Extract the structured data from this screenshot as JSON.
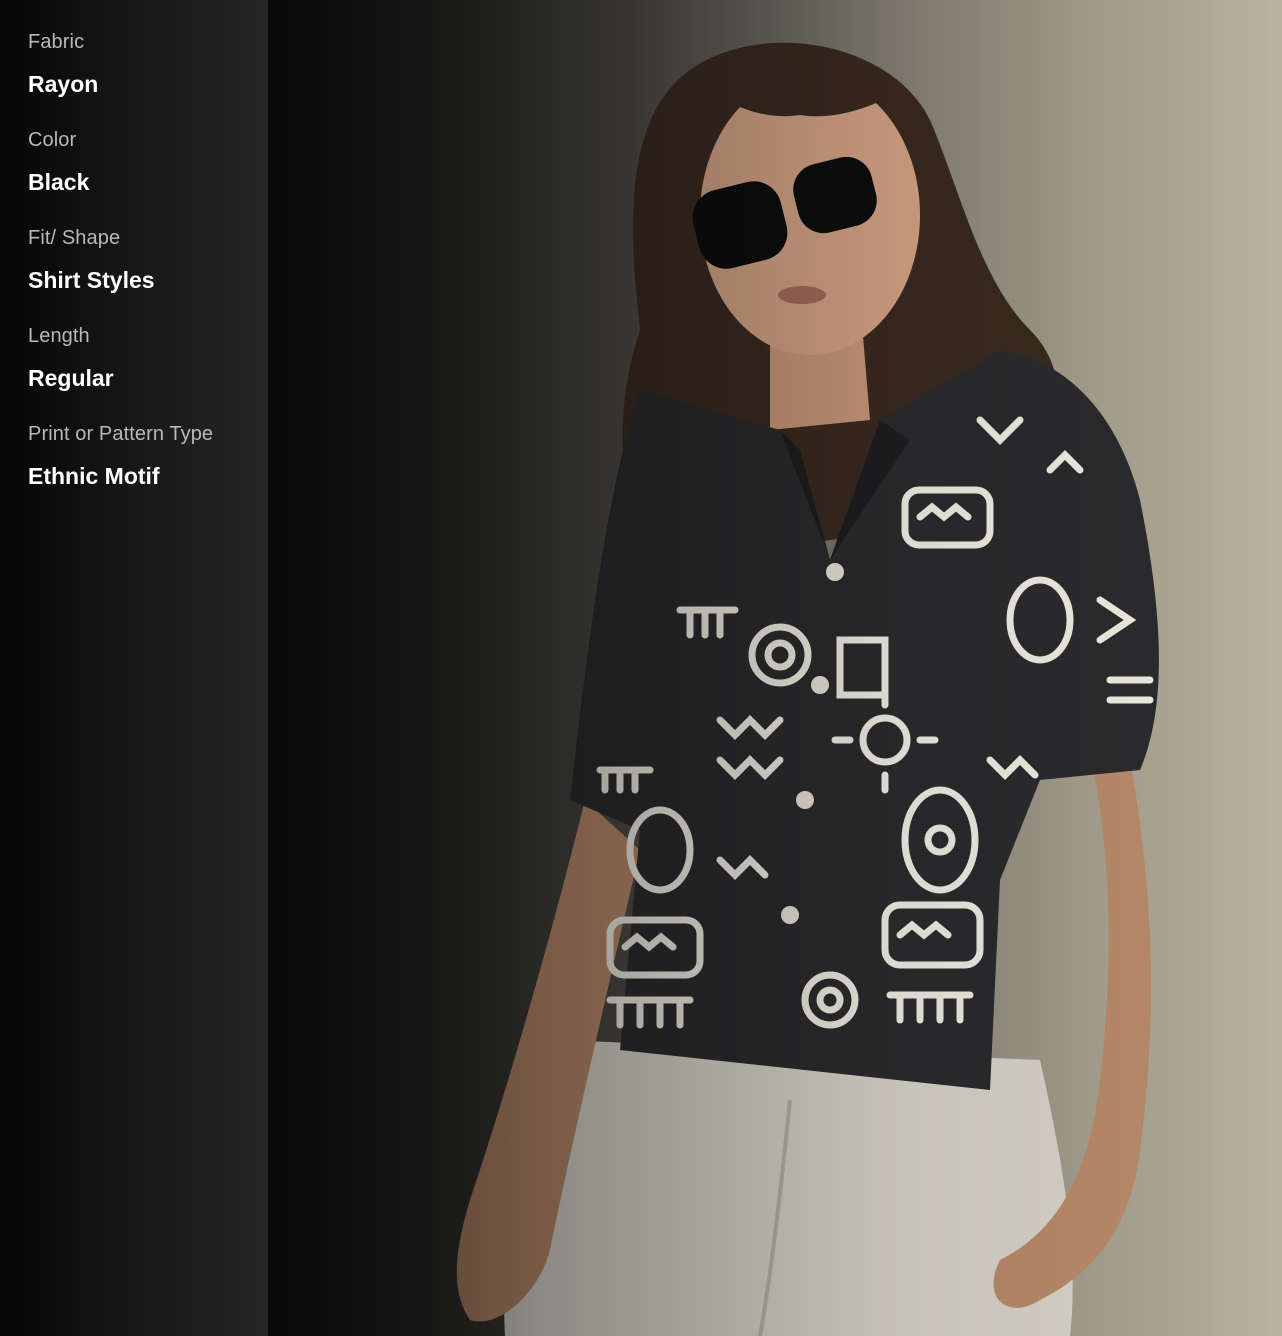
{
  "attributes": [
    {
      "label": "Fabric",
      "value": "Rayon"
    },
    {
      "label": "Color",
      "value": "Black"
    },
    {
      "label": "Fit/ Shape",
      "value": "Shirt Styles"
    },
    {
      "label": "Length",
      "value": "Regular"
    },
    {
      "label": "Print or Pattern Type",
      "value": "Ethnic Motif"
    }
  ],
  "colors": {
    "panel_background": "#1a1a1a",
    "label_text": "#b9b9b9",
    "value_text": "#ffffff",
    "shirt": "#2b2b2d",
    "shirt_print": "#efece2",
    "trousers": "#d7d3c8"
  }
}
